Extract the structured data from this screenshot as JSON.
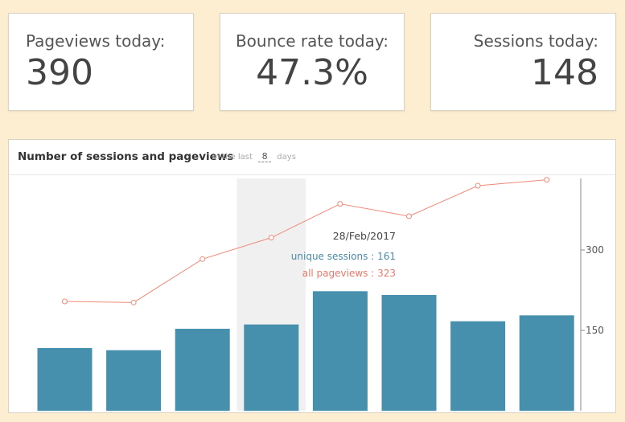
{
  "stats": {
    "pageviews": {
      "label": "Pageviews today:",
      "value": "390"
    },
    "bounce": {
      "label": "Bounce rate today:",
      "value": "47.3%"
    },
    "sessions": {
      "label": "Sessions today:",
      "value": "148"
    }
  },
  "chart_panel": {
    "title": "Number of sessions and pageviews",
    "in_the_last": "in the last",
    "days_value": "8",
    "days_unit": "days"
  },
  "colors": {
    "background": "#fdeed2",
    "bar": "#4790ad",
    "line": "#f08a78",
    "highlight": "#f0f0f0",
    "tooltip_sessions": "#4a8ca8",
    "tooltip_pageviews": "#e8796a"
  },
  "tooltip": {
    "date": "28/Feb/2017",
    "sessions_text": "unique sessions : 161",
    "pageviews_text": "all pageviews : 323"
  },
  "chart_data": {
    "type": "bar",
    "title": "Number of sessions and pageviews",
    "categories": [
      "",
      "",
      "",
      "28/Feb/2017",
      "",
      "",
      "",
      ""
    ],
    "series": [
      {
        "name": "unique sessions",
        "type": "bar",
        "values": [
          117,
          113,
          153,
          161,
          223,
          216,
          167,
          178
        ]
      },
      {
        "name": "all pageviews",
        "type": "line",
        "values": [
          204,
          202,
          283,
          323,
          386,
          363,
          420,
          431
        ]
      }
    ],
    "yticks": [
      150,
      300
    ],
    "ylim": [
      0,
      435
    ],
    "y_axis_position": "right",
    "highlighted_index": 3,
    "grid": false
  }
}
